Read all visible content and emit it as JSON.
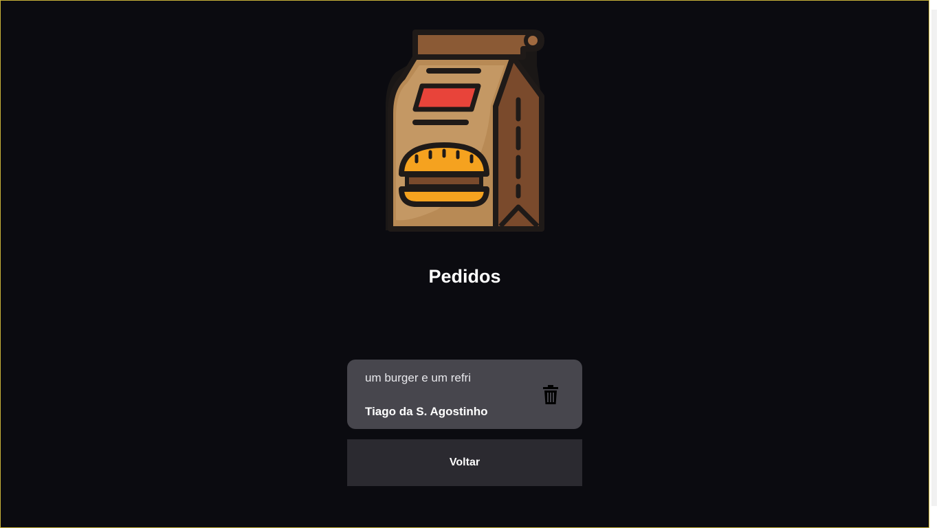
{
  "header": {
    "logo_icon": "burger-bag-icon",
    "title": "Pedidos"
  },
  "orders": [
    {
      "description": "um burger e um refri",
      "customer": "Tiago da S. Agostinho",
      "delete_icon": "trash-icon"
    }
  ],
  "actions": {
    "back_label": "Voltar"
  },
  "colors": {
    "background": "#0b0b10",
    "card": "#47464d",
    "button": "#2b2a30",
    "bag": "#b88a55",
    "bag_dark": "#7a4a2c",
    "bun": "#f5a21f",
    "label_red": "#e8443a"
  }
}
